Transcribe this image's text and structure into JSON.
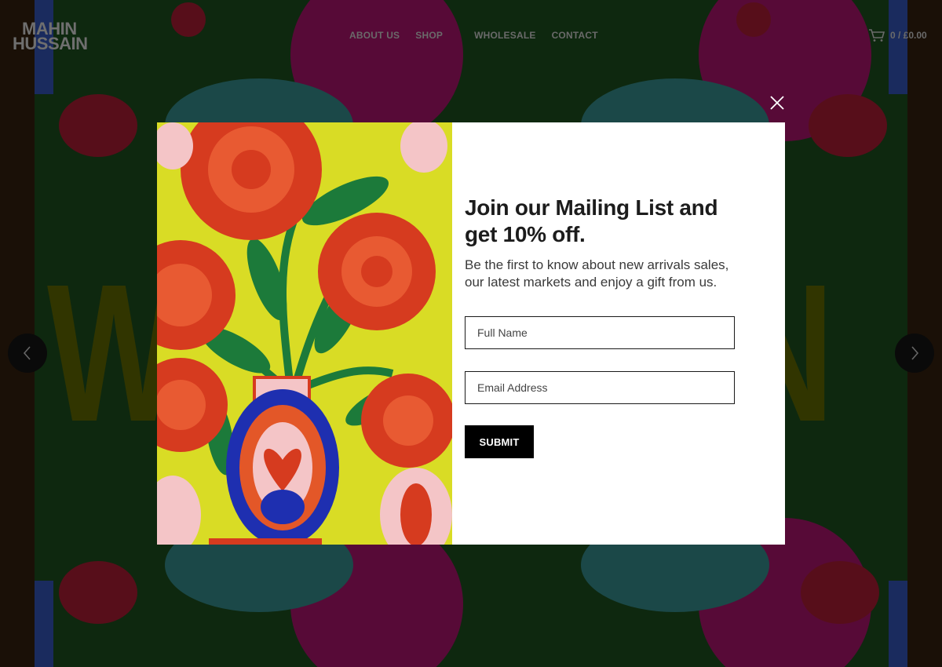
{
  "header": {
    "logo_line1": "MAHIN",
    "logo_line2": "HUSSAIN",
    "nav": [
      {
        "label": "ABOUT US"
      },
      {
        "label": "SHOP"
      },
      {
        "label": "WHOLESALE"
      },
      {
        "label": "CONTACT"
      }
    ],
    "cart_text": "0 / £0.00",
    "cart_icon": "cart-icon"
  },
  "hero": {
    "letter_left": "W",
    "letter_right": "N"
  },
  "slider": {
    "prev_icon": "chevron-left-icon",
    "next_icon": "chevron-right-icon"
  },
  "popup": {
    "close_icon": "close-icon",
    "image_description_icon": "flower-vase-illustration",
    "headline": "Join our Mailing List and get 10% off.",
    "subtext": "Be the first to know about new arrivals sales, our latest markets and enjoy a gift from us.",
    "name_placeholder": "Full Name",
    "email_placeholder": "Email Address",
    "submit_label": "SUBMIT"
  },
  "colors": {
    "overlay": "#000000",
    "hero_text": "#6e7500",
    "submit_bg": "#000000",
    "illustration_bg": "#d9dc25"
  }
}
